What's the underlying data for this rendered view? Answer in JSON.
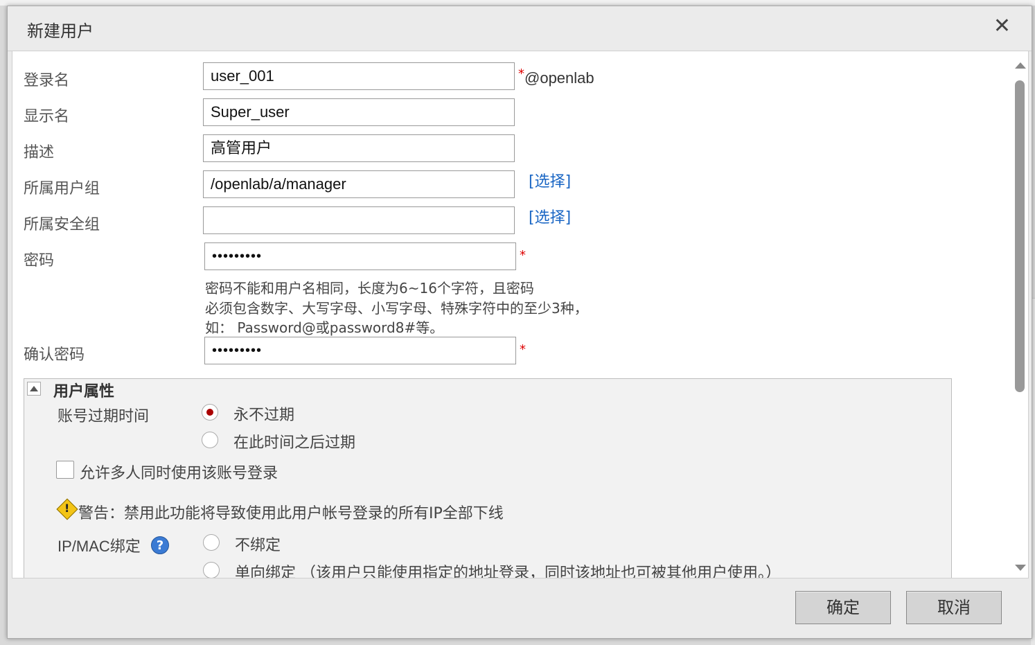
{
  "dialog": {
    "title": "新建用户",
    "close_icon": "close-icon"
  },
  "form": {
    "login_name": {
      "label": "登录名",
      "value": "user_001",
      "required": "*",
      "suffix": "@openlab"
    },
    "display_name": {
      "label": "显示名",
      "value": "Super_user"
    },
    "description": {
      "label": "描述",
      "value": "高管用户"
    },
    "user_group": {
      "label": "所属用户组",
      "value": "/openlab/a/manager",
      "select_link": "[选择]"
    },
    "security_group": {
      "label": "所属安全组",
      "value": "",
      "select_link": "[选择]"
    },
    "password": {
      "label": "密码",
      "value": "•••••••••",
      "required": "*",
      "hint_lines": [
        "密码不能和用户名相同，长度为6~16个字符，且密码",
        "必须包含数字、大写字母、小写字母、特殊字符中的至少3种，",
        "如：  Password@或password8#等。"
      ]
    },
    "confirm_password": {
      "label": "确认密码",
      "value": "•••••••••",
      "required": "*"
    }
  },
  "user_attributes": {
    "title": "用户属性",
    "expire_label": "账号过期时间",
    "expire_options": [
      "永不过期",
      "在此时间之后过期"
    ],
    "expire_selected": "永不过期",
    "multi_login_label": "允许多人同时使用该账号登录",
    "multi_login_checked": false,
    "warning_text": "警告：禁用此功能将导致使用此用户帐号登录的所有IP全部下线",
    "ipmac_label": "IP/MAC绑定",
    "ipmac_options": [
      "不绑定",
      "单向绑定 （该用户只能使用指定的地址登录，同时该地址也可被其他用户使用。）"
    ]
  },
  "footer": {
    "ok_label": "确定",
    "cancel_label": "取消"
  },
  "colors": {
    "link": "#1a66c4",
    "required": "#dd0000",
    "radio_selected": "#aa0000",
    "warning": "#f3c417",
    "help": "#3b7bd4"
  }
}
